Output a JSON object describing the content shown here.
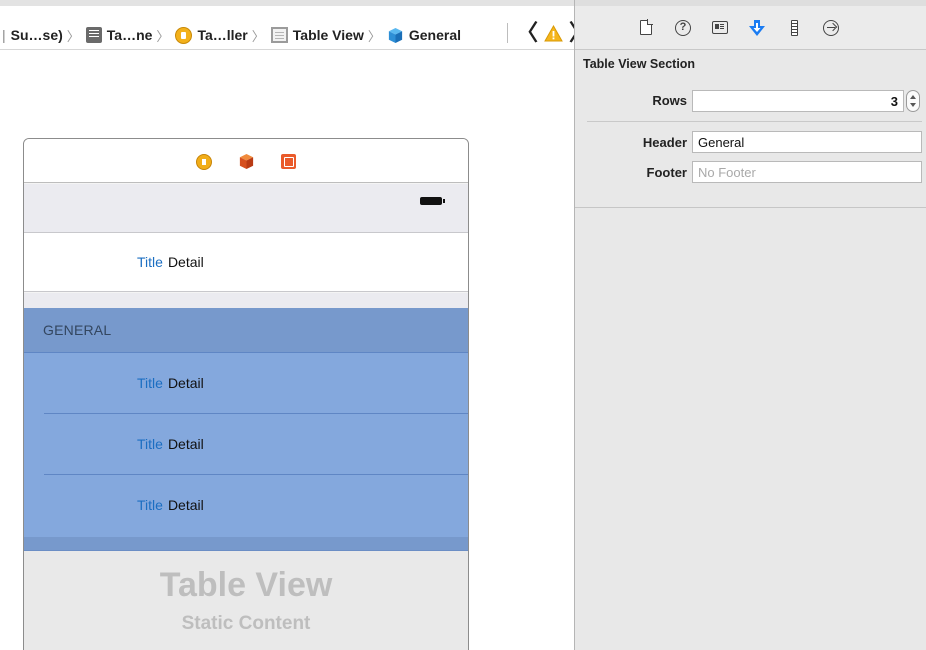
{
  "breadcrumb": {
    "items": [
      {
        "label": "Su…se)",
        "icon": "folder-fragment"
      },
      {
        "label": "Ta…ne",
        "icon": "file-icon"
      },
      {
        "label": "Ta…ller",
        "icon": "view-controller-icon"
      },
      {
        "label": "Table View",
        "icon": "table-view-icon"
      },
      {
        "label": "General",
        "icon": "cube-icon"
      }
    ],
    "leading_glyph": "|",
    "separator": "〉",
    "back_glyph": "〈",
    "forward_glyph": "〉",
    "warning_color": "#f5b51c"
  },
  "scene": {
    "dock_icons": [
      "view-controller-icon",
      "first-responder-icon",
      "exit-icon"
    ],
    "static_cell": {
      "title": "Title",
      "detail": "Detail"
    },
    "selected_section": {
      "header": "GENERAL",
      "rows": [
        {
          "title": "Title",
          "detail": "Detail"
        },
        {
          "title": "Title",
          "detail": "Detail"
        },
        {
          "title": "Title",
          "detail": "Detail"
        }
      ]
    },
    "watermark": {
      "title": "Table View",
      "subtitle": "Static Content"
    },
    "selection_color": "#84a8dd",
    "title_color": "#1b6ec2"
  },
  "inspector": {
    "tabs": [
      {
        "name": "file-inspector"
      },
      {
        "name": "quick-help-inspector"
      },
      {
        "name": "identity-inspector"
      },
      {
        "name": "attributes-inspector",
        "active": true
      },
      {
        "name": "size-inspector"
      },
      {
        "name": "connections-inspector"
      }
    ],
    "active_color": "#1b7cf2",
    "section_title": "Table View Section",
    "rows": {
      "label": "Rows",
      "value": "3"
    },
    "header": {
      "label": "Header",
      "value": "General"
    },
    "footer": {
      "label": "Footer",
      "placeholder": "No Footer",
      "value": ""
    }
  }
}
